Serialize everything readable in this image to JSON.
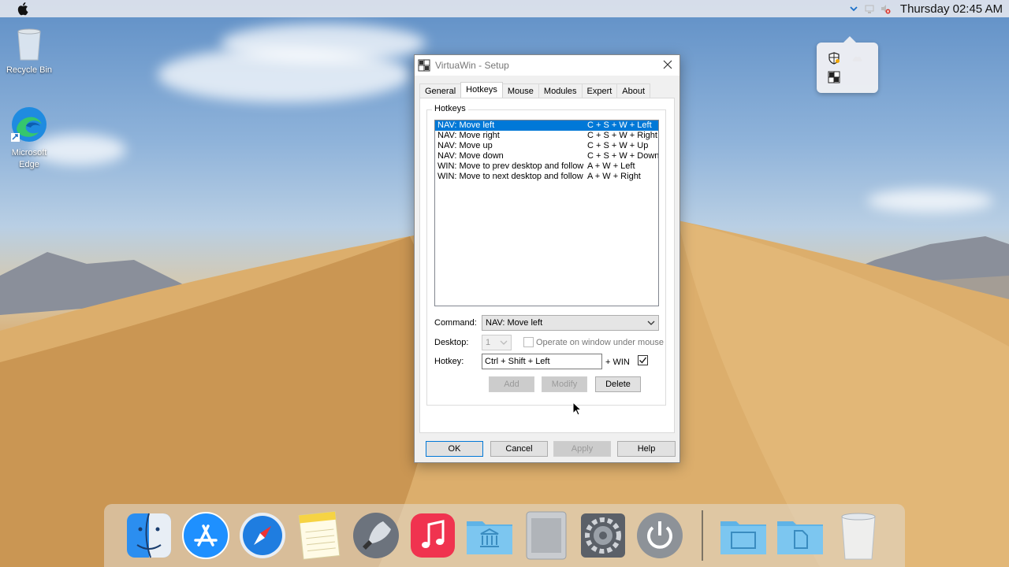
{
  "menubar": {
    "clock": "Thursday 02:45 AM"
  },
  "desktop": {
    "icons": [
      {
        "label": "Recycle Bin"
      },
      {
        "label": "Microsoft Edge"
      }
    ]
  },
  "dialog": {
    "title": "VirtuaWin - Setup",
    "tabs": [
      "General",
      "Hotkeys",
      "Mouse",
      "Modules",
      "Expert",
      "About"
    ],
    "active_tab": "Hotkeys",
    "group_label": "Hotkeys",
    "hotkeys": [
      {
        "command": "NAV: Move left",
        "keys": "C + S + W + Left",
        "selected": true
      },
      {
        "command": "NAV: Move right",
        "keys": "C + S + W + Right",
        "selected": false
      },
      {
        "command": "NAV: Move up",
        "keys": "C + S + W + Up",
        "selected": false
      },
      {
        "command": "NAV: Move down",
        "keys": "C + S + W + Down",
        "selected": false
      },
      {
        "command": "WIN: Move to prev desktop and follow",
        "keys": "A + W + Left",
        "selected": false
      },
      {
        "command": "WIN: Move to next desktop and follow",
        "keys": "A + W + Right",
        "selected": false
      }
    ],
    "command_label": "Command:",
    "command_value": "NAV: Move left",
    "desktop_label": "Desktop:",
    "desktop_value": "1",
    "operate_label": "Operate on window under mouse",
    "hotkey_label": "Hotkey:",
    "hotkey_value": "Ctrl + Shift + Left",
    "win_label": "+ WIN",
    "buttons": {
      "add": "Add",
      "modify": "Modify",
      "delete": "Delete",
      "ok": "OK",
      "cancel": "Cancel",
      "apply": "Apply",
      "help": "Help"
    }
  },
  "dock": {
    "items": [
      "finder-icon",
      "app-store-icon",
      "safari-icon",
      "notes-icon",
      "launchpad-icon",
      "music-icon",
      "library-folder-icon",
      "mac-pro-icon",
      "system-preferences-icon",
      "power-icon",
      "documents-folder-icon",
      "file-folder-icon",
      "trash-icon"
    ]
  }
}
